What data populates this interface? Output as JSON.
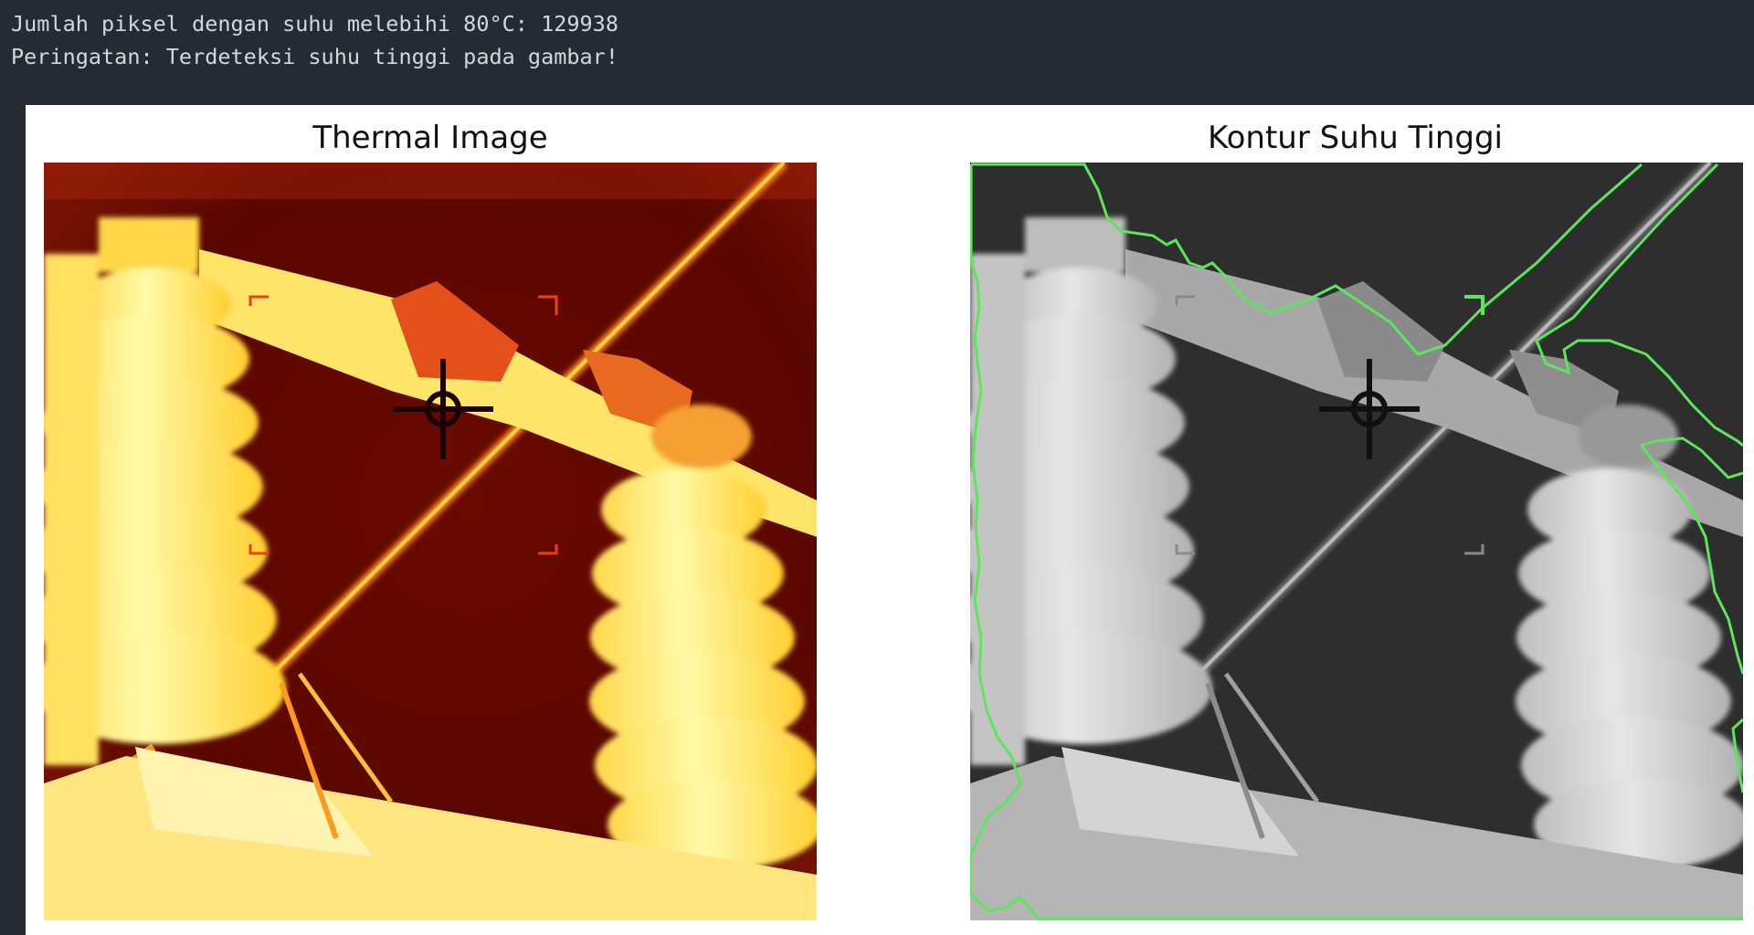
{
  "console": {
    "line1": "Jumlah piksel dengan suhu melebihi 80°C: 129938",
    "line2": "Peringatan: Terdeteksi suhu tinggi pada gambar!"
  },
  "figure": {
    "left_title": "Thermal Image",
    "right_title": "Kontur Suhu Tinggi",
    "contour_color": "#5ce65c",
    "thermal_colormap": "hot",
    "right_colormap": "gray"
  }
}
